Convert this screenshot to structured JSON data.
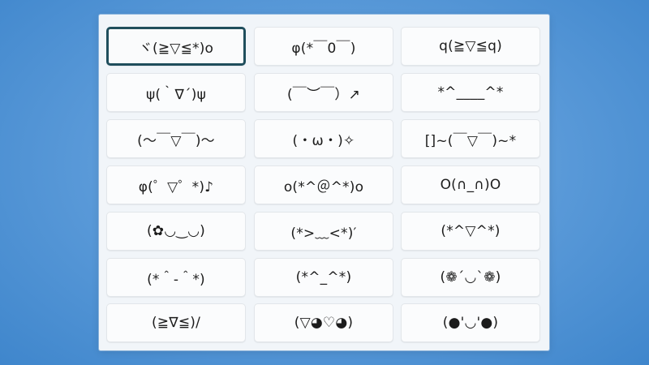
{
  "emoji_panel": {
    "selected_index": 0,
    "items": [
      {
        "label": "ヾ(≧▽≦*)o"
      },
      {
        "label": "φ(*￣0￣)"
      },
      {
        "label": "q(≧▽≦q)"
      },
      {
        "label": "ψ(｀∇´)ψ"
      },
      {
        "label": "(￣︶￣）↗"
      },
      {
        "label": "*^____^*"
      },
      {
        "label": "(～￣▽￣)～"
      },
      {
        "label": "(・ω・)✧"
      },
      {
        "label": "[]~(￣▽￣)~*"
      },
      {
        "label": "φ(゜▽゜*)♪"
      },
      {
        "label": "o(*^＠^*)o"
      },
      {
        "label": "O(∩_∩)O"
      },
      {
        "label": "(✿◡‿◡)"
      },
      {
        "label": "(*>﹏<*)′"
      },
      {
        "label": "(*^▽^*)"
      },
      {
        "label": "(*＾-＾*)"
      },
      {
        "label": "(*^_^*)"
      },
      {
        "label": "(❁´◡`❁)"
      },
      {
        "label": "(≧∇≦)/"
      },
      {
        "label": "(▽◕♡◕)"
      },
      {
        "label": "(●'◡'●)"
      }
    ]
  }
}
